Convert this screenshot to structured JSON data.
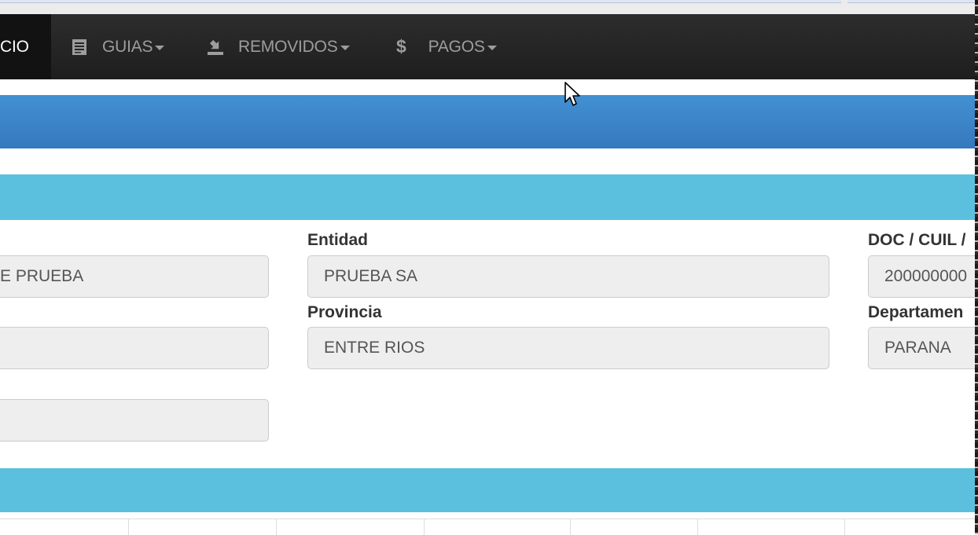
{
  "nav": {
    "items": [
      {
        "label": "CIO",
        "icon": "home-icon"
      },
      {
        "label": "GUIAS",
        "icon": "list-icon"
      },
      {
        "label": "REMOVIDOS",
        "icon": "download-icon"
      },
      {
        "label": "PAGOS",
        "icon": "$"
      }
    ]
  },
  "form": {
    "col1": {
      "field1_value": "E PRUEBA",
      "field2_value": "",
      "field3_value": ""
    },
    "entidad": {
      "label": "Entidad",
      "value": "PRUEBA SA"
    },
    "provincia": {
      "label": "Provincia",
      "value": "ENTRE RIOS"
    },
    "doc": {
      "label": "DOC / CUIL /",
      "value": "200000000"
    },
    "departamento": {
      "label": "Departamen",
      "value": "PARANA"
    }
  },
  "colors": {
    "navbar": "#222222",
    "primary_bar": "#3a85c8",
    "info_bar": "#5bc0de",
    "field_bg": "#eeeeee"
  }
}
